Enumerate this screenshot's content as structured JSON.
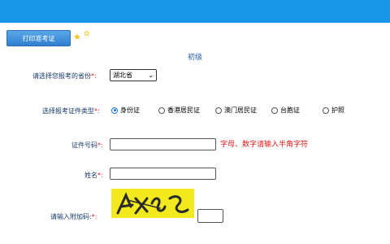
{
  "header": {
    "print_button": "打印准考证"
  },
  "form": {
    "title": "初级",
    "province": {
      "label": "请选择您报考的省份",
      "required_mark": "*:",
      "selected": "湖北省"
    },
    "id_type": {
      "label": "选择报考证件类型",
      "required_mark": "*:",
      "options": [
        "身份证",
        "香港居民证",
        "澳门居民证",
        "台胞证",
        "护照"
      ],
      "selected_index": 0
    },
    "id_number": {
      "label": "证件号码",
      "required_mark": "*:",
      "value": "",
      "hint": "字母、数字请输入半角字符"
    },
    "name": {
      "label": "姓名",
      "required_mark": "*:",
      "value": ""
    },
    "captcha": {
      "label": "请输入附加码:",
      "required_mark": "*:",
      "value": ""
    }
  },
  "colors": {
    "top_bar": "#1a96e8",
    "required": "#e01b1b",
    "captcha_bg": "#f2ea1e"
  },
  "icons": [
    "star-icon",
    "star-icon",
    "chevron-down-icon"
  ]
}
